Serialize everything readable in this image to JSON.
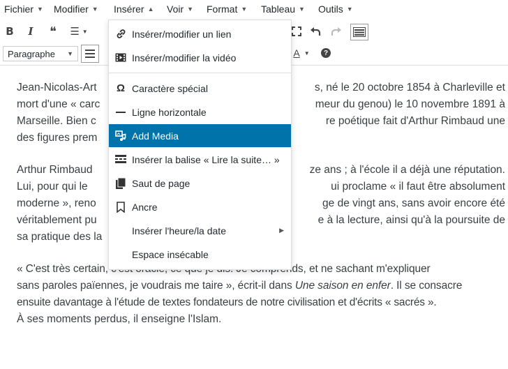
{
  "menubar": {
    "items": [
      {
        "label": "Fichier",
        "caret": "▼"
      },
      {
        "label": "Modifier",
        "caret": "▼"
      },
      {
        "label": "Insérer",
        "caret": "▲"
      },
      {
        "label": "Voir",
        "caret": "▼"
      },
      {
        "label": "Format",
        "caret": "▼"
      },
      {
        "label": "Tableau",
        "caret": "▼"
      },
      {
        "label": "Outils",
        "caret": "▼"
      }
    ]
  },
  "toolbar": {
    "bold": "B",
    "italic": "I",
    "quote": "❝",
    "list": "☰",
    "format_select": "Paragraphe",
    "help": "?"
  },
  "dropdown": {
    "items": [
      {
        "label": "Insérer/modifier un lien",
        "icon": "link-icon"
      },
      {
        "label": "Insérer/modifier la vidéo",
        "icon": "video-icon"
      },
      {
        "label": "Caractère spécial",
        "icon": "omega-icon"
      },
      {
        "label": "Ligne horizontale",
        "icon": "horizontal-line-icon"
      },
      {
        "label": "Add Media",
        "icon": "media-icon",
        "active": true
      },
      {
        "label": "Insérer la balise « Lire la suite… »",
        "icon": "read-more-icon"
      },
      {
        "label": "Saut de page",
        "icon": "page-break-icon"
      },
      {
        "label": "Ancre",
        "icon": "bookmark-icon"
      },
      {
        "label": "Insérer l'heure/la date",
        "icon": "",
        "submenu": true
      },
      {
        "label": "Espace insécable",
        "icon": ""
      }
    ],
    "active_color": "#0073aa"
  },
  "content": {
    "p1_left": "Jean-Nicolas-Art",
    "p1_right": "s, né le 20 octobre 1854 à Charleville et",
    "p1_l2_left": "mort d'une « carc",
    "p1_l2_right": "meur du genou) le 10 novembre 1891 à",
    "p1_l3_left": "Marseille. Bien c",
    "p1_l3_right": "re poétique fait d'Arthur Rimbaud une",
    "p1_l4_left": "des figures prem",
    "p2_l1_left": "Arthur Rimbaud",
    "p2_l1_right": "ze ans ; à l'école il a déjà une réputation.",
    "p2_l2_left": "Lui, pour qui le",
    "p2_l2_right": "ui proclame « il faut être absolument",
    "p2_l3_left": "moderne », reno",
    "p2_l3_right": "ge de vingt ans, sans avoir encore été",
    "p2_l4_left": "véritablement pu",
    "p2_l4_right": "e à la lecture, ainsi qu'à la poursuite de",
    "p2_l5_left": "sa pratique des la",
    "p3_l1": "« C'est très certain, c'est oracle, ce que je dis. Je comprends, et ne sachant m'expliquer",
    "p3_l2_a": "sans paroles païennes, je voudrais me taire », écrit-il dans ",
    "p3_l2_em": "Une saison en enfer",
    "p3_l2_b": ". Il se consacre",
    "p3_l3": "ensuite davantage à l'étude de textes fondateurs de notre civilisation et d'écrits « sacrés ».",
    "p3_l4": "À ses moments perdus, il enseigne l'Islam."
  }
}
